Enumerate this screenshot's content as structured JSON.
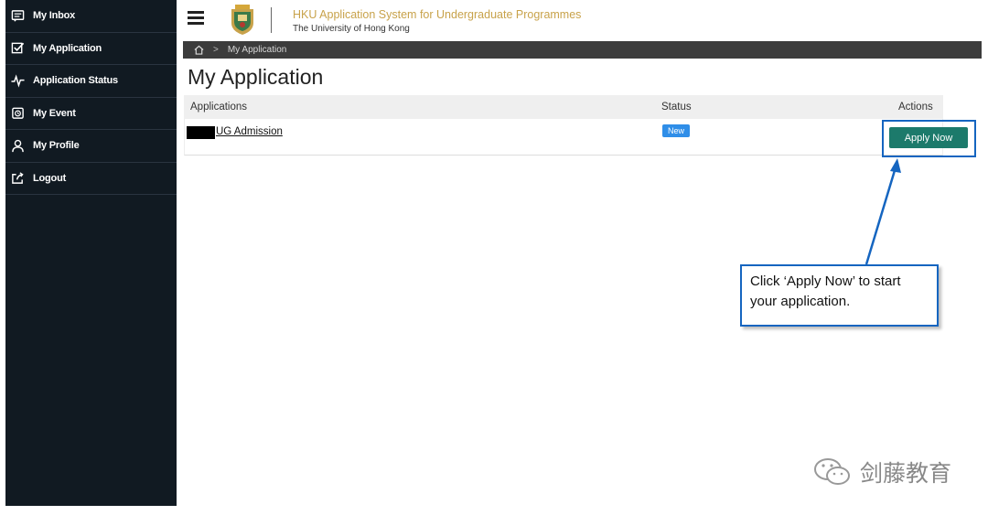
{
  "sidebar": {
    "items": [
      {
        "label": "My Inbox",
        "icon": "inbox-icon"
      },
      {
        "label": "My Application",
        "icon": "checkbox-icon"
      },
      {
        "label": "Application Status",
        "icon": "pulse-icon"
      },
      {
        "label": "My Event",
        "icon": "calendar-icon"
      },
      {
        "label": "My Profile",
        "icon": "user-icon"
      },
      {
        "label": "Logout",
        "icon": "logout-icon"
      }
    ]
  },
  "header": {
    "title": "HKU Application System for Undergraduate Programmes",
    "subtitle": "The University of Hong Kong",
    "title_color": "#c8a24a"
  },
  "breadcrumb": {
    "home_icon": "home-icon",
    "separator": ">",
    "current": "My Application"
  },
  "main": {
    "page_title": "My Application",
    "table": {
      "headers": {
        "applications": "Applications",
        "status": "Status",
        "actions": "Actions"
      },
      "rows": [
        {
          "application": "UG Admission",
          "status": "New",
          "action": "Apply Now"
        }
      ]
    }
  },
  "annotation": {
    "callout_line1": "Click ‘Apply Now’ to start",
    "callout_line2": "your application."
  },
  "watermark": {
    "text": "剑藤教育",
    "icon": "wechat-icon"
  },
  "colors": {
    "sidebar_bg": "#111a22",
    "accent_gold": "#c8a24a",
    "button_teal": "#1c7a6b",
    "badge_blue": "#2f8ee8",
    "annotation_blue": "#1565c0"
  }
}
